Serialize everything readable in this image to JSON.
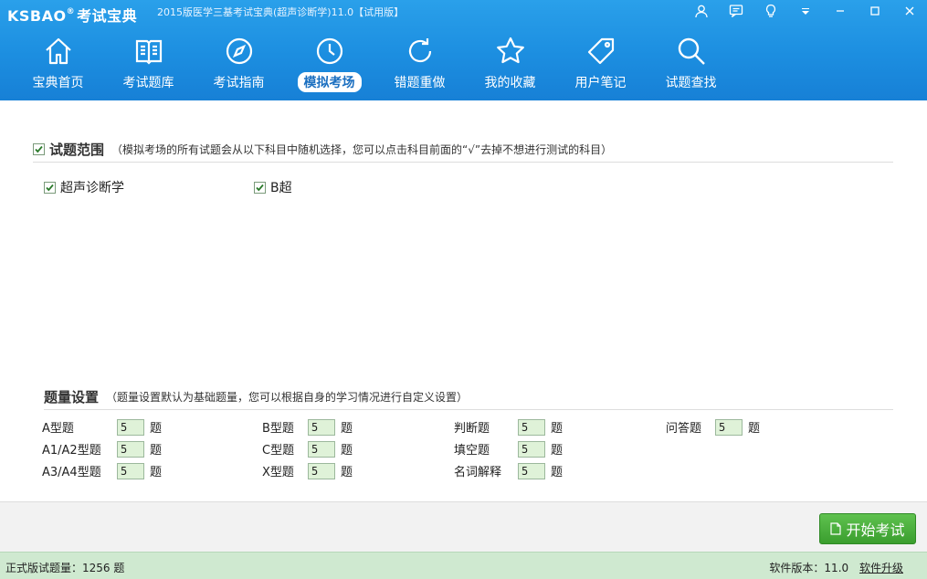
{
  "app": {
    "logo_text": "KSBAO",
    "logo_reg": "®",
    "logo_cn": "考试宝典",
    "title": "2015版医学三基考试宝典(超声诊断学)11.0【试用版】"
  },
  "nav": [
    {
      "label": "宝典首页",
      "icon": "home-icon",
      "active": false
    },
    {
      "label": "考试题库",
      "icon": "book-icon",
      "active": false
    },
    {
      "label": "考试指南",
      "icon": "compass-icon",
      "active": false
    },
    {
      "label": "模拟考场",
      "icon": "clock-icon",
      "active": true
    },
    {
      "label": "错题重做",
      "icon": "refresh-icon",
      "active": false
    },
    {
      "label": "我的收藏",
      "icon": "star-icon",
      "active": false
    },
    {
      "label": "用户笔记",
      "icon": "tag-icon",
      "active": false
    },
    {
      "label": "试题查找",
      "icon": "search-icon",
      "active": false
    }
  ],
  "scope": {
    "title": "试题范围",
    "note": "（模拟考场的所有试题会从以下科目中随机选择，您可以点击科目前面的“√”去掉不想进行测试的科目）",
    "subjects": [
      {
        "label": "超声诊断学",
        "checked": true
      },
      {
        "label": "B超",
        "checked": true
      }
    ]
  },
  "quantity": {
    "title": "题量设置",
    "note": "（题量设置默认为基础题量，您可以根据自身的学习情况进行自定义设置）",
    "suffix": "题",
    "items": [
      {
        "label": "A型题",
        "value": "5"
      },
      {
        "label": "A1/A2型题",
        "value": "5"
      },
      {
        "label": "A3/A4型题",
        "value": "5"
      },
      {
        "label": "B型题",
        "value": "5"
      },
      {
        "label": "C型题",
        "value": "5"
      },
      {
        "label": "X型题",
        "value": "5"
      },
      {
        "label": "判断题",
        "value": "5"
      },
      {
        "label": "填空题",
        "value": "5"
      },
      {
        "label": "名词解释",
        "value": "5"
      },
      {
        "label": "问答题",
        "value": "5"
      }
    ]
  },
  "start_button": "开始考试",
  "status": {
    "left": "正式版试题量：1256 题",
    "version": "软件版本：11.0",
    "upgrade": "软件升级"
  }
}
